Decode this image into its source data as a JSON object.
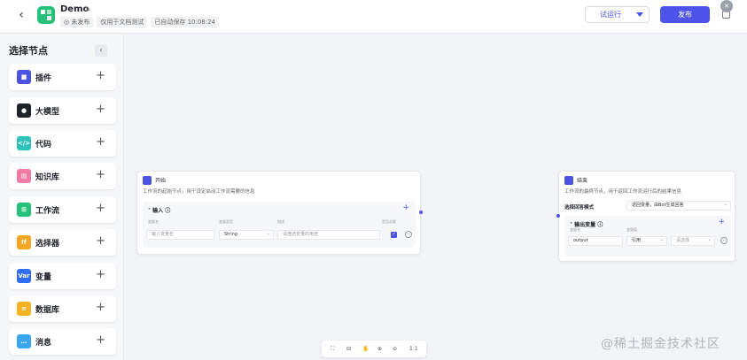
{
  "header": {
    "title": "Demo",
    "meta": [
      "◎ 未发布",
      "仅用于文档测试",
      "已自动保存 10:08:24"
    ],
    "run_label": "试运行",
    "publish_label": "发布"
  },
  "sidebar": {
    "title": "选择节点",
    "items": [
      {
        "label": "插件",
        "icon": "plugin-icon",
        "color": "#4b53e0",
        "glyph": "■"
      },
      {
        "label": "大模型",
        "icon": "llm-icon",
        "color": "#1f2329",
        "glyph": "●"
      },
      {
        "label": "代码",
        "icon": "code-icon",
        "color": "#2fc2b8",
        "glyph": "</>"
      },
      {
        "label": "知识库",
        "icon": "knowledge-icon",
        "color": "#f07ba0",
        "glyph": "▤"
      },
      {
        "label": "工作流",
        "icon": "workflow-icon",
        "color": "#27c07a",
        "glyph": "⊞"
      },
      {
        "label": "选择器",
        "icon": "selector-icon",
        "color": "#f5a623",
        "glyph": "If"
      },
      {
        "label": "变量",
        "icon": "variable-icon",
        "color": "#2f6ef5",
        "glyph": "Var"
      },
      {
        "label": "数据库",
        "icon": "database-icon",
        "color": "#f5b323",
        "glyph": "≡"
      },
      {
        "label": "消息",
        "icon": "message-icon",
        "color": "#3aa6f0",
        "glyph": "…"
      }
    ]
  },
  "start_node": {
    "title": "开始",
    "desc": "工作流的起始节点，用于设定启动工作流需要的信息",
    "section": "输入",
    "col_headers": [
      "变量名",
      "变量类型",
      "描述",
      "是否必要"
    ],
    "var_placeholder": "输入变量名",
    "type_value": "String",
    "desc_placeholder": "请描述变量的用途"
  },
  "end_node": {
    "title": "结束",
    "desc": "工作流的最终节点，用于返回工作流运行后的结果信息",
    "mode_label": "选择回答模式",
    "mode_value": "返回变量，由Bot生成回答",
    "section": "输出变量",
    "col_headers": [
      "变量名",
      "变量值"
    ],
    "var_value": "output",
    "ref_value": "引用",
    "select_placeholder": "请选择"
  },
  "toolbar": {
    "zoom_label": "1:1"
  },
  "watermark": "@稀土掘金技术社区"
}
